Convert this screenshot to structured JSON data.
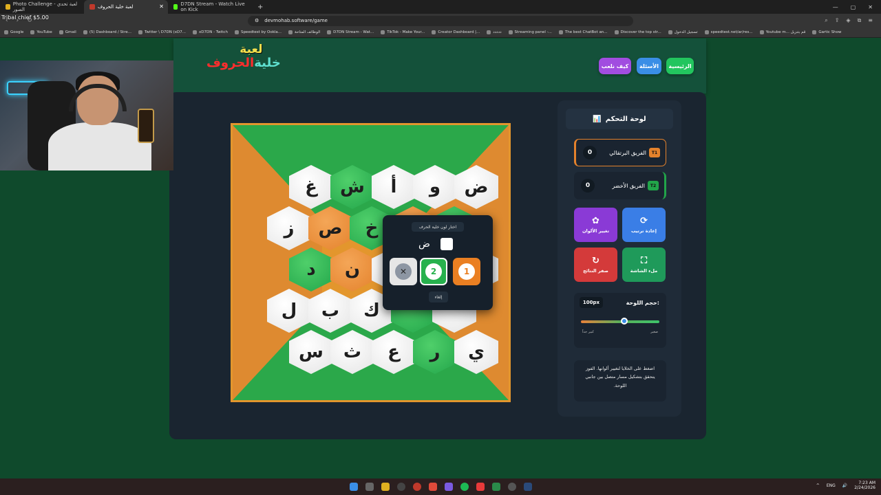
{
  "browser": {
    "tabs": [
      {
        "label": "Photo Challenge - لعبة تحدي الصور",
        "color": "#e0b020"
      },
      {
        "label": "لعبة خلية الحروف",
        "color": "#c0392b"
      },
      {
        "label": "D7DN Stream - Watch Live on Kick",
        "color": "#53fc18"
      }
    ],
    "new_tab": "+",
    "url": "devmohab.software/game",
    "bookmarks": [
      "Google",
      "YouTube",
      "Gmail",
      "(5) Dashboard / Stre...",
      "Twitter \\ D7DN (xD7...",
      "xD7DN - Twitch",
      "Speedtest by Ookla...",
      "الوظائف المتاحة",
      "D7DN Stream - Wat...",
      "TikTok - Make Your...",
      "Creator Dashboard |...",
      "ددددد",
      "Streaming panel -...",
      "The best ChatBot an...",
      "Discover the top str...",
      "تسجيل الدخول",
      "speedtest.net/ar/res...",
      "Youtube m... قم بتنزيل",
      "Gartic Show"
    ]
  },
  "overlay": {
    "text": "Tribal chief $5.00"
  },
  "site": {
    "logo_line1": "لعبة",
    "logo_line2a": "خلية",
    "logo_line2b": "الحروف",
    "nav": {
      "home": "الرئيسية",
      "questions": "الأسئلة",
      "how_to": "كيف نلعب"
    }
  },
  "board": {
    "rows": [
      [
        {
          "l": "غ",
          "c": "white"
        },
        {
          "l": "ش",
          "c": "green"
        },
        {
          "l": "أ",
          "c": "white"
        },
        {
          "l": "و",
          "c": "white"
        },
        {
          "l": "ض",
          "c": "white"
        }
      ],
      [
        {
          "l": "ز",
          "c": "white"
        },
        {
          "l": "ص",
          "c": "orange"
        },
        {
          "l": "خ",
          "c": "green"
        },
        {
          "l": "",
          "c": "orange"
        },
        {
          "l": "",
          "c": "green"
        }
      ],
      [
        {
          "l": "د",
          "c": "green"
        },
        {
          "l": "ن",
          "c": "orange"
        },
        {
          "l": "",
          "c": "white"
        },
        {
          "l": "",
          "c": "white"
        },
        {
          "l": "",
          "c": "white"
        }
      ],
      [
        {
          "l": "ل",
          "c": "white"
        },
        {
          "l": "ب",
          "c": "white"
        },
        {
          "l": "ك",
          "c": "white"
        },
        {
          "l": "",
          "c": "green"
        },
        {
          "l": "",
          "c": "white"
        }
      ],
      [
        {
          "l": "س",
          "c": "white"
        },
        {
          "l": "ث",
          "c": "white"
        },
        {
          "l": "ع",
          "c": "white"
        },
        {
          "l": "ر",
          "c": "green"
        },
        {
          "l": "ي",
          "c": "white"
        }
      ]
    ]
  },
  "popup": {
    "title": "اختار لون خلية الحرف",
    "letter": "ض",
    "clear": "✕",
    "team2": "2",
    "team1": "1",
    "cancel": "إلغاء"
  },
  "panel": {
    "title": "لوحة التحكم",
    "title_icon": "bar-chart-icon",
    "orange_team": {
      "name": "الفريق البرتقالي",
      "tag": "T1",
      "score": "0"
    },
    "green_team": {
      "name": "الفريق الأخضر",
      "tag": "T2",
      "score": "0"
    },
    "shuffle": "إعادة ترتيب",
    "change_colors": "تغيير الألوان",
    "fullscreen": "ملء الشاشة",
    "reset_scores": "صفر النتائج",
    "size_label": "حجم اللوحة:",
    "size_value": "100px",
    "size_fraction": 0.55,
    "size_small": "صغير",
    "size_large": "كبير جداً",
    "hint": "اضغط على الخلايا لتغيير ألوانها. الفوز يتحقق بتشكيل مسار متصل بين جانبي اللوحة."
  },
  "taskbar": {
    "time": "7:23 AM",
    "date": "2/24/2026",
    "lang": "ENG"
  },
  "colors": {
    "green": "#22a54a",
    "orange": "#e4822c",
    "blue": "#3a8ee6",
    "purple": "#8a3ad6",
    "red": "#d43a3a"
  }
}
